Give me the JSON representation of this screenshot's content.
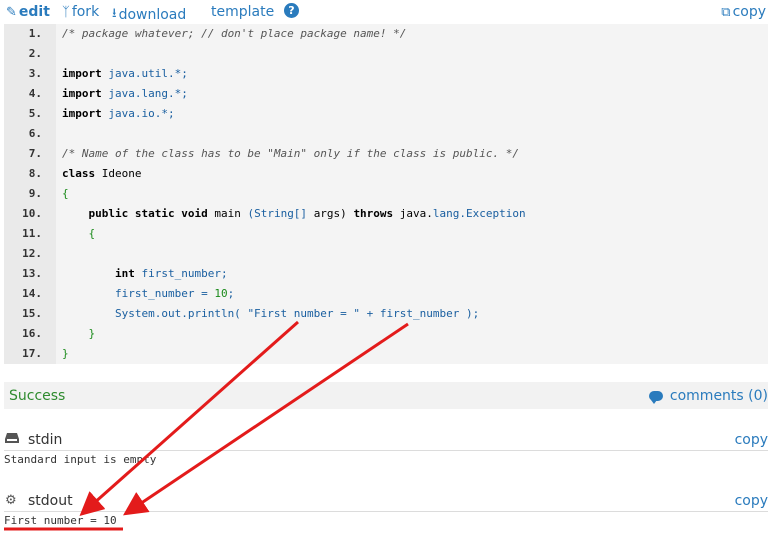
{
  "toolbar": {
    "edit": "edit",
    "fork": "fork",
    "download": "download",
    "template": "template",
    "help": "?",
    "copy": "copy"
  },
  "code": {
    "lines": [
      {
        "n": "1.",
        "tokens": [
          {
            "t": "/* package whatever; // don't place package name! */",
            "c": "cm"
          }
        ]
      },
      {
        "n": "2.",
        "tokens": []
      },
      {
        "n": "3.",
        "tokens": [
          {
            "t": "import ",
            "c": "kw"
          },
          {
            "t": "java.util.*;",
            "c": "pkg"
          }
        ]
      },
      {
        "n": "4.",
        "tokens": [
          {
            "t": "import ",
            "c": "kw"
          },
          {
            "t": "java.lang.*;",
            "c": "pkg"
          }
        ]
      },
      {
        "n": "5.",
        "tokens": [
          {
            "t": "import ",
            "c": "kw"
          },
          {
            "t": "java.io.*;",
            "c": "pkg"
          }
        ]
      },
      {
        "n": "6.",
        "tokens": []
      },
      {
        "n": "7.",
        "tokens": [
          {
            "t": "/* Name of the class has to be \"Main\" only if the class is public. */",
            "c": "cm"
          }
        ]
      },
      {
        "n": "8.",
        "tokens": [
          {
            "t": "class ",
            "c": "kw"
          },
          {
            "t": "Ideone",
            "c": ""
          }
        ]
      },
      {
        "n": "9.",
        "tokens": [
          {
            "t": "{",
            "c": "pun"
          }
        ]
      },
      {
        "n": "10.",
        "tokens": [
          {
            "t": "    public static void ",
            "c": "kw"
          },
          {
            "t": "main ",
            "c": ""
          },
          {
            "t": "(String[] ",
            "c": "pkg"
          },
          {
            "t": "args) ",
            "c": ""
          },
          {
            "t": "throws ",
            "c": "kw"
          },
          {
            "t": "java.",
            "c": ""
          },
          {
            "t": "lang.Exception",
            "c": "pkg"
          }
        ]
      },
      {
        "n": "11.",
        "tokens": [
          {
            "t": "    {",
            "c": "pun"
          }
        ]
      },
      {
        "n": "12.",
        "tokens": []
      },
      {
        "n": "13.",
        "tokens": [
          {
            "t": "        int ",
            "c": "kw"
          },
          {
            "t": "first_number;",
            "c": "pkg"
          }
        ]
      },
      {
        "n": "14.",
        "tokens": [
          {
            "t": "        first_number = ",
            "c": "pkg"
          },
          {
            "t": "10",
            "c": "num"
          },
          {
            "t": ";",
            "c": "pkg"
          }
        ]
      },
      {
        "n": "15.",
        "tokens": [
          {
            "t": "        System.out.println( ",
            "c": "pkg"
          },
          {
            "t": "\"First number = \"",
            "c": "str"
          },
          {
            "t": " + first_number );",
            "c": "pkg"
          }
        ]
      },
      {
        "n": "16.",
        "tokens": [
          {
            "t": "    }",
            "c": "pun"
          }
        ]
      },
      {
        "n": "17.",
        "tokens": [
          {
            "t": "}",
            "c": "pun"
          }
        ]
      }
    ]
  },
  "result": {
    "status": "Success",
    "comments": "comments (0)"
  },
  "stdin": {
    "title": "stdin",
    "copy": "copy",
    "content": "Standard input is empty"
  },
  "stdout": {
    "title": "stdout",
    "copy": "copy",
    "content": "First number = 10"
  },
  "colors": {
    "link": "#2a7bbd",
    "success": "#2e8b2e",
    "annotation": "#e31b1b"
  }
}
